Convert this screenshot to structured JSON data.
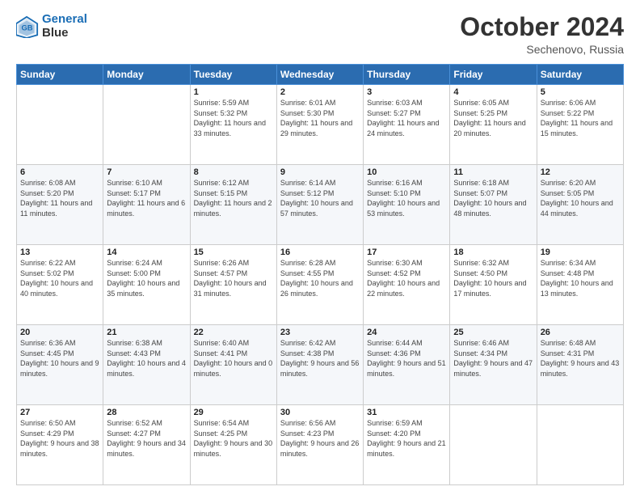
{
  "header": {
    "logo_line1": "General",
    "logo_line2": "Blue",
    "main_title": "October 2024",
    "subtitle": "Sechenovo, Russia"
  },
  "days_of_week": [
    "Sunday",
    "Monday",
    "Tuesday",
    "Wednesday",
    "Thursday",
    "Friday",
    "Saturday"
  ],
  "weeks": [
    [
      {
        "day": "",
        "sunrise": "",
        "sunset": "",
        "daylight": ""
      },
      {
        "day": "",
        "sunrise": "",
        "sunset": "",
        "daylight": ""
      },
      {
        "day": "1",
        "sunrise": "Sunrise: 5:59 AM",
        "sunset": "Sunset: 5:32 PM",
        "daylight": "Daylight: 11 hours and 33 minutes."
      },
      {
        "day": "2",
        "sunrise": "Sunrise: 6:01 AM",
        "sunset": "Sunset: 5:30 PM",
        "daylight": "Daylight: 11 hours and 29 minutes."
      },
      {
        "day": "3",
        "sunrise": "Sunrise: 6:03 AM",
        "sunset": "Sunset: 5:27 PM",
        "daylight": "Daylight: 11 hours and 24 minutes."
      },
      {
        "day": "4",
        "sunrise": "Sunrise: 6:05 AM",
        "sunset": "Sunset: 5:25 PM",
        "daylight": "Daylight: 11 hours and 20 minutes."
      },
      {
        "day": "5",
        "sunrise": "Sunrise: 6:06 AM",
        "sunset": "Sunset: 5:22 PM",
        "daylight": "Daylight: 11 hours and 15 minutes."
      }
    ],
    [
      {
        "day": "6",
        "sunrise": "Sunrise: 6:08 AM",
        "sunset": "Sunset: 5:20 PM",
        "daylight": "Daylight: 11 hours and 11 minutes."
      },
      {
        "day": "7",
        "sunrise": "Sunrise: 6:10 AM",
        "sunset": "Sunset: 5:17 PM",
        "daylight": "Daylight: 11 hours and 6 minutes."
      },
      {
        "day": "8",
        "sunrise": "Sunrise: 6:12 AM",
        "sunset": "Sunset: 5:15 PM",
        "daylight": "Daylight: 11 hours and 2 minutes."
      },
      {
        "day": "9",
        "sunrise": "Sunrise: 6:14 AM",
        "sunset": "Sunset: 5:12 PM",
        "daylight": "Daylight: 10 hours and 57 minutes."
      },
      {
        "day": "10",
        "sunrise": "Sunrise: 6:16 AM",
        "sunset": "Sunset: 5:10 PM",
        "daylight": "Daylight: 10 hours and 53 minutes."
      },
      {
        "day": "11",
        "sunrise": "Sunrise: 6:18 AM",
        "sunset": "Sunset: 5:07 PM",
        "daylight": "Daylight: 10 hours and 48 minutes."
      },
      {
        "day": "12",
        "sunrise": "Sunrise: 6:20 AM",
        "sunset": "Sunset: 5:05 PM",
        "daylight": "Daylight: 10 hours and 44 minutes."
      }
    ],
    [
      {
        "day": "13",
        "sunrise": "Sunrise: 6:22 AM",
        "sunset": "Sunset: 5:02 PM",
        "daylight": "Daylight: 10 hours and 40 minutes."
      },
      {
        "day": "14",
        "sunrise": "Sunrise: 6:24 AM",
        "sunset": "Sunset: 5:00 PM",
        "daylight": "Daylight: 10 hours and 35 minutes."
      },
      {
        "day": "15",
        "sunrise": "Sunrise: 6:26 AM",
        "sunset": "Sunset: 4:57 PM",
        "daylight": "Daylight: 10 hours and 31 minutes."
      },
      {
        "day": "16",
        "sunrise": "Sunrise: 6:28 AM",
        "sunset": "Sunset: 4:55 PM",
        "daylight": "Daylight: 10 hours and 26 minutes."
      },
      {
        "day": "17",
        "sunrise": "Sunrise: 6:30 AM",
        "sunset": "Sunset: 4:52 PM",
        "daylight": "Daylight: 10 hours and 22 minutes."
      },
      {
        "day": "18",
        "sunrise": "Sunrise: 6:32 AM",
        "sunset": "Sunset: 4:50 PM",
        "daylight": "Daylight: 10 hours and 17 minutes."
      },
      {
        "day": "19",
        "sunrise": "Sunrise: 6:34 AM",
        "sunset": "Sunset: 4:48 PM",
        "daylight": "Daylight: 10 hours and 13 minutes."
      }
    ],
    [
      {
        "day": "20",
        "sunrise": "Sunrise: 6:36 AM",
        "sunset": "Sunset: 4:45 PM",
        "daylight": "Daylight: 10 hours and 9 minutes."
      },
      {
        "day": "21",
        "sunrise": "Sunrise: 6:38 AM",
        "sunset": "Sunset: 4:43 PM",
        "daylight": "Daylight: 10 hours and 4 minutes."
      },
      {
        "day": "22",
        "sunrise": "Sunrise: 6:40 AM",
        "sunset": "Sunset: 4:41 PM",
        "daylight": "Daylight: 10 hours and 0 minutes."
      },
      {
        "day": "23",
        "sunrise": "Sunrise: 6:42 AM",
        "sunset": "Sunset: 4:38 PM",
        "daylight": "Daylight: 9 hours and 56 minutes."
      },
      {
        "day": "24",
        "sunrise": "Sunrise: 6:44 AM",
        "sunset": "Sunset: 4:36 PM",
        "daylight": "Daylight: 9 hours and 51 minutes."
      },
      {
        "day": "25",
        "sunrise": "Sunrise: 6:46 AM",
        "sunset": "Sunset: 4:34 PM",
        "daylight": "Daylight: 9 hours and 47 minutes."
      },
      {
        "day": "26",
        "sunrise": "Sunrise: 6:48 AM",
        "sunset": "Sunset: 4:31 PM",
        "daylight": "Daylight: 9 hours and 43 minutes."
      }
    ],
    [
      {
        "day": "27",
        "sunrise": "Sunrise: 6:50 AM",
        "sunset": "Sunset: 4:29 PM",
        "daylight": "Daylight: 9 hours and 38 minutes."
      },
      {
        "day": "28",
        "sunrise": "Sunrise: 6:52 AM",
        "sunset": "Sunset: 4:27 PM",
        "daylight": "Daylight: 9 hours and 34 minutes."
      },
      {
        "day": "29",
        "sunrise": "Sunrise: 6:54 AM",
        "sunset": "Sunset: 4:25 PM",
        "daylight": "Daylight: 9 hours and 30 minutes."
      },
      {
        "day": "30",
        "sunrise": "Sunrise: 6:56 AM",
        "sunset": "Sunset: 4:23 PM",
        "daylight": "Daylight: 9 hours and 26 minutes."
      },
      {
        "day": "31",
        "sunrise": "Sunrise: 6:59 AM",
        "sunset": "Sunset: 4:20 PM",
        "daylight": "Daylight: 9 hours and 21 minutes."
      },
      {
        "day": "",
        "sunrise": "",
        "sunset": "",
        "daylight": ""
      },
      {
        "day": "",
        "sunrise": "",
        "sunset": "",
        "daylight": ""
      }
    ]
  ]
}
